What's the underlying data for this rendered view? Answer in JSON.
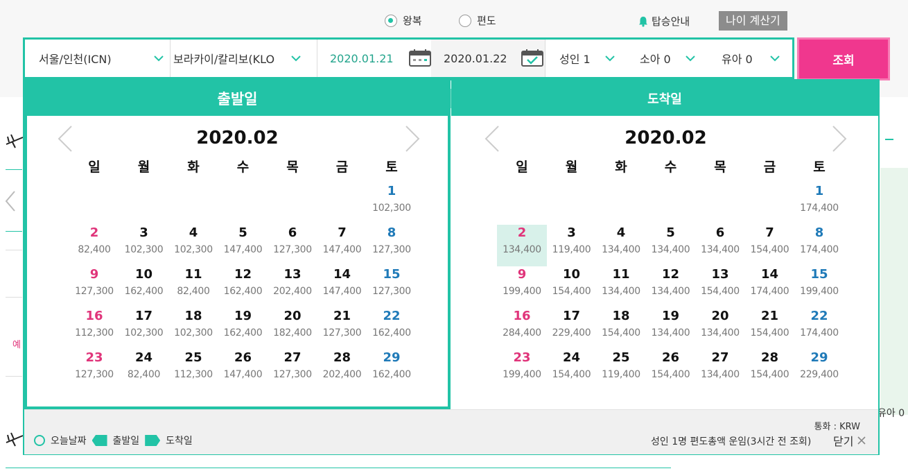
{
  "trip_type": {
    "round_trip": "왕복",
    "one_way": "편도",
    "selected": "round_trip"
  },
  "boarding_info": "탑승안내",
  "age_calculator": "나이 계산기",
  "search": {
    "origin": "서울/인천(ICN)",
    "destination": "보라카이/칼리보(KLO)",
    "depart_date": "2020.01.21",
    "return_date": "2020.01.22",
    "adult": "성인 1",
    "child": "소아 0",
    "infant": "유아 0",
    "submit": "조회"
  },
  "colors": {
    "accent": "#22c3a6",
    "submit": "#f0378e",
    "sunday": "#e0347a",
    "saturday": "#1f7ab8"
  },
  "calendar": {
    "weekdays": [
      "일",
      "월",
      "화",
      "수",
      "목",
      "금",
      "토"
    ],
    "departure": {
      "tab": "출발일",
      "month": "2020.02",
      "weeks": [
        [
          {
            "d": "",
            "p": ""
          },
          {
            "d": "",
            "p": ""
          },
          {
            "d": "",
            "p": ""
          },
          {
            "d": "",
            "p": ""
          },
          {
            "d": "",
            "p": ""
          },
          {
            "d": "",
            "p": ""
          },
          {
            "d": "1",
            "p": "102,300"
          }
        ],
        [
          {
            "d": "2",
            "p": "82,400"
          },
          {
            "d": "3",
            "p": "102,300"
          },
          {
            "d": "4",
            "p": "102,300"
          },
          {
            "d": "5",
            "p": "147,400"
          },
          {
            "d": "6",
            "p": "127,300"
          },
          {
            "d": "7",
            "p": "147,400"
          },
          {
            "d": "8",
            "p": "127,300"
          }
        ],
        [
          {
            "d": "9",
            "p": "127,300"
          },
          {
            "d": "10",
            "p": "162,400"
          },
          {
            "d": "11",
            "p": "82,400"
          },
          {
            "d": "12",
            "p": "162,400"
          },
          {
            "d": "13",
            "p": "202,400"
          },
          {
            "d": "14",
            "p": "147,400"
          },
          {
            "d": "15",
            "p": "127,300"
          }
        ],
        [
          {
            "d": "16",
            "p": "112,300"
          },
          {
            "d": "17",
            "p": "102,300"
          },
          {
            "d": "18",
            "p": "102,300"
          },
          {
            "d": "19",
            "p": "162,400"
          },
          {
            "d": "20",
            "p": "182,400"
          },
          {
            "d": "21",
            "p": "127,300"
          },
          {
            "d": "22",
            "p": "162,400"
          }
        ],
        [
          {
            "d": "23",
            "p": "127,300"
          },
          {
            "d": "24",
            "p": "82,400"
          },
          {
            "d": "25",
            "p": "112,300"
          },
          {
            "d": "26",
            "p": "147,400"
          },
          {
            "d": "27",
            "p": "127,300"
          },
          {
            "d": "28",
            "p": "202,400"
          },
          {
            "d": "29",
            "p": "162,400"
          }
        ]
      ]
    },
    "arrival": {
      "tab": "도착일",
      "month": "2020.02",
      "selected_day": "2",
      "weeks": [
        [
          {
            "d": "",
            "p": ""
          },
          {
            "d": "",
            "p": ""
          },
          {
            "d": "",
            "p": ""
          },
          {
            "d": "",
            "p": ""
          },
          {
            "d": "",
            "p": ""
          },
          {
            "d": "",
            "p": ""
          },
          {
            "d": "1",
            "p": "174,400"
          }
        ],
        [
          {
            "d": "2",
            "p": "134,400"
          },
          {
            "d": "3",
            "p": "119,400"
          },
          {
            "d": "4",
            "p": "134,400"
          },
          {
            "d": "5",
            "p": "134,400"
          },
          {
            "d": "6",
            "p": "134,400"
          },
          {
            "d": "7",
            "p": "154,400"
          },
          {
            "d": "8",
            "p": "174,400"
          }
        ],
        [
          {
            "d": "9",
            "p": "199,400"
          },
          {
            "d": "10",
            "p": "154,400"
          },
          {
            "d": "11",
            "p": "134,400"
          },
          {
            "d": "12",
            "p": "134,400"
          },
          {
            "d": "13",
            "p": "154,400"
          },
          {
            "d": "14",
            "p": "174,400"
          },
          {
            "d": "15",
            "p": "199,400"
          }
        ],
        [
          {
            "d": "16",
            "p": "284,400"
          },
          {
            "d": "17",
            "p": "229,400"
          },
          {
            "d": "18",
            "p": "154,400"
          },
          {
            "d": "19",
            "p": "134,400"
          },
          {
            "d": "20",
            "p": "134,400"
          },
          {
            "d": "21",
            "p": "154,400"
          },
          {
            "d": "22",
            "p": "174,400"
          }
        ],
        [
          {
            "d": "23",
            "p": "199,400"
          },
          {
            "d": "24",
            "p": "154,400"
          },
          {
            "d": "25",
            "p": "119,400"
          },
          {
            "d": "26",
            "p": "154,400"
          },
          {
            "d": "27",
            "p": "134,400"
          },
          {
            "d": "28",
            "p": "154,400"
          },
          {
            "d": "29",
            "p": "229,400"
          }
        ]
      ]
    },
    "legend": {
      "today": "오늘날짜",
      "departure": "출발일",
      "arrival": "도착일"
    },
    "currency": "통화 : KRW",
    "fare_note": "성인 1명 편도총액 운임(3시간 전 조회)",
    "close": "닫기"
  },
  "background": {
    "side_text_left": "예",
    "side_text_right": "유아 0"
  }
}
